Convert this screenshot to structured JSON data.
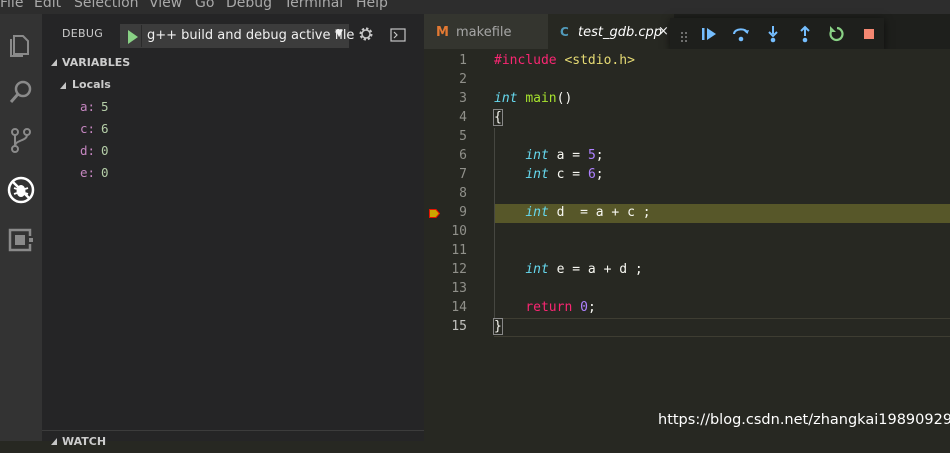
{
  "menubar": {
    "items": [
      "File",
      "Edit",
      "Selection",
      "View",
      "Go",
      "Debug",
      "Terminal",
      "Help"
    ]
  },
  "activity_bar": {
    "icons": [
      "files-icon",
      "search-icon",
      "source-control-icon",
      "debug-icon",
      "extensions-icon"
    ],
    "active": "debug-icon"
  },
  "debug_toolbar": {
    "title": "DEBUG",
    "launch_config": "g++ build and debug active file",
    "caret": "▼"
  },
  "variables_section": {
    "header": "VARIABLES",
    "scope": "Locals",
    "vars": [
      {
        "name": "a:",
        "value": "5"
      },
      {
        "name": "c:",
        "value": "6"
      },
      {
        "name": "d:",
        "value": "0"
      },
      {
        "name": "e:",
        "value": "0"
      }
    ]
  },
  "watch_section": {
    "header": "WATCH"
  },
  "tabs": [
    {
      "icon_glyph": "M",
      "label": "makefile",
      "active": false
    },
    {
      "icon_glyph": "C",
      "label": "test_gdb.cpp",
      "active": true,
      "close": "×"
    }
  ],
  "floating_debug_toolbar": {
    "buttons": [
      "continue-icon",
      "step-over-icon",
      "step-into-icon",
      "step-out-icon",
      "restart-icon",
      "stop-icon"
    ]
  },
  "editor": {
    "current_line": 9,
    "active_line": 15,
    "lines": [
      {
        "n": "1",
        "text": "#include <stdio.h>"
      },
      {
        "n": "2",
        "text": ""
      },
      {
        "n": "3",
        "text": "int main()"
      },
      {
        "n": "4",
        "text": "{"
      },
      {
        "n": "5",
        "text": ""
      },
      {
        "n": "6",
        "text": "    int a = 5;"
      },
      {
        "n": "7",
        "text": "    int c = 6;"
      },
      {
        "n": "8",
        "text": ""
      },
      {
        "n": "9",
        "text": "    int d  = a + c ;"
      },
      {
        "n": "10",
        "text": ""
      },
      {
        "n": "11",
        "text": ""
      },
      {
        "n": "12",
        "text": "    int e = a + d ;"
      },
      {
        "n": "13",
        "text": ""
      },
      {
        "n": "14",
        "text": "    return 0;"
      },
      {
        "n": "15",
        "text": "}"
      }
    ]
  },
  "watermark": "https://blog.csdn.net/zhangkai19890929",
  "colors": {
    "accent_orange": "#e37933",
    "debug_blue": "#75beff",
    "debug_green": "#89d185",
    "stop_red": "#f48771",
    "current_line_bg": "#575729",
    "keyword_pink": "#f92672",
    "type_cyan": "#66d9ef",
    "number_purple": "#ae81ff",
    "string_yellow": "#e6db74"
  }
}
